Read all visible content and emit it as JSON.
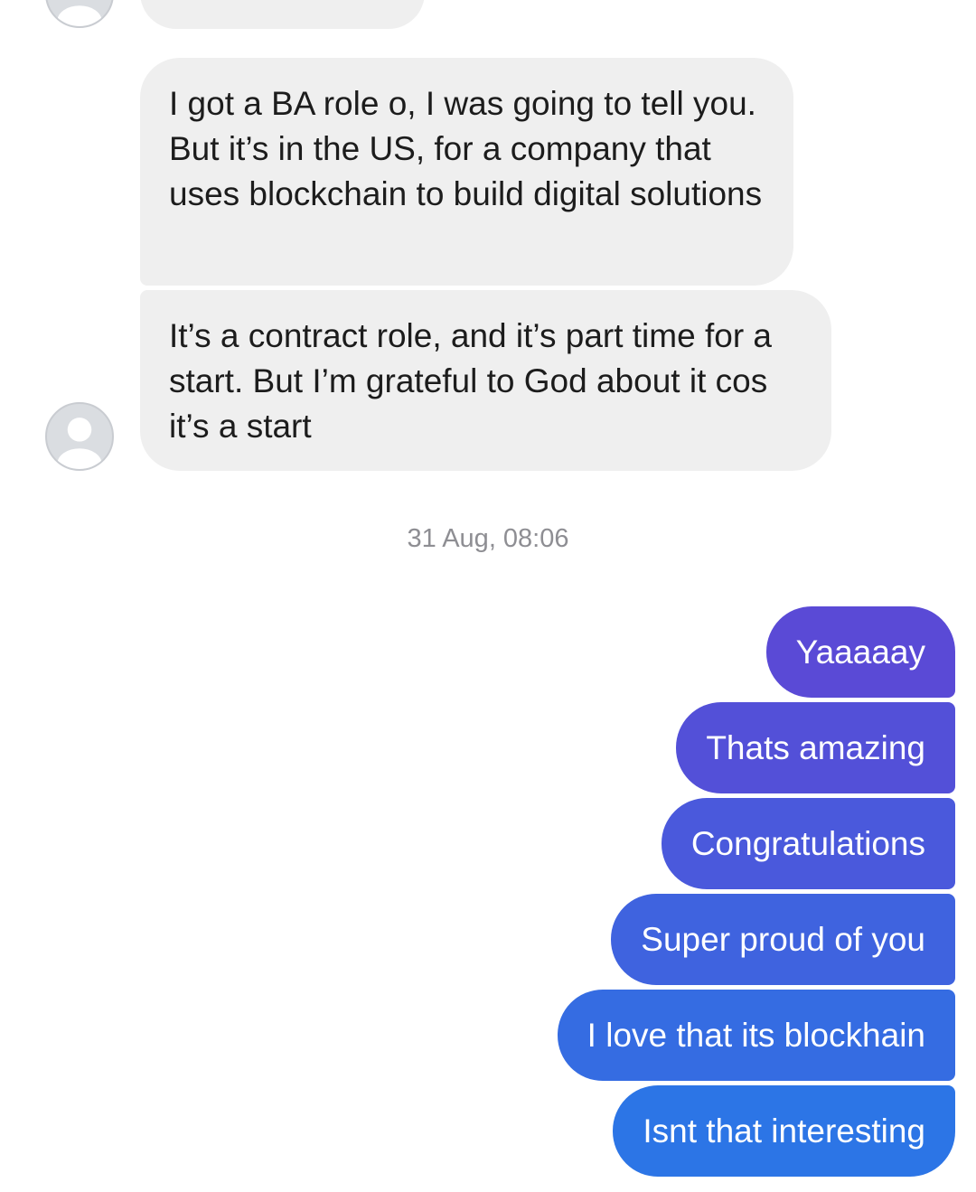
{
  "conversation": {
    "incoming": [
      {
        "text": "I got a BA role o, I was going to tell you. But it’s in the US, for a company that uses blockchain to build digital solutions"
      },
      {
        "text": "It’s a contract role, and it’s part time for a start. But I’m grateful to God about it cos it’s a start"
      }
    ],
    "timestamp": "31 Aug, 08:06",
    "outgoing": [
      {
        "text": "Yaaaaay"
      },
      {
        "text": "Thats amazing"
      },
      {
        "text": "Congratulations"
      },
      {
        "text": "Super proud of you"
      },
      {
        "text": "I love that its blockhain"
      },
      {
        "text": "Isnt that interesting"
      }
    ]
  },
  "icons": {
    "avatar": "person-silhouette-icon"
  },
  "colors": {
    "incoming_bubble": "#efefef",
    "outgoing_gradient_start": "#5a4ad6",
    "outgoing_gradient_end": "#2c75e6",
    "timestamp_text": "#8e8e93"
  }
}
